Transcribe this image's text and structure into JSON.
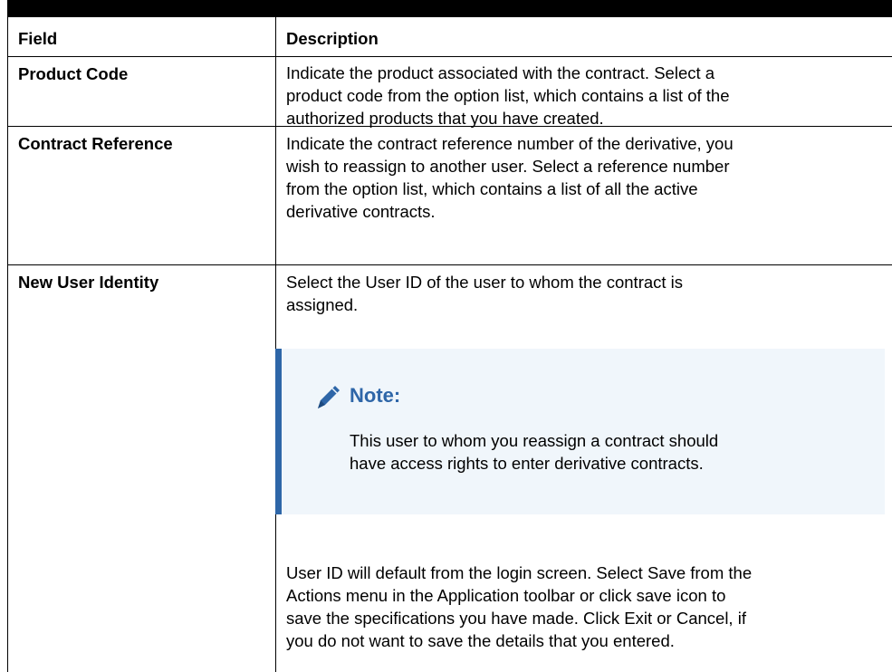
{
  "table": {
    "header": {
      "field": "Field",
      "description": "Description"
    },
    "rows": [
      {
        "field": "Product Code",
        "description": "Indicate the product associated with the contract. Select a\nproduct code from the option list, which contains a list of the\nauthorized products that you have created."
      },
      {
        "field": "Contract Reference",
        "description": "Indicate the contract reference number of the derivative, you\nwish to reassign to another user. Select a reference number\nfrom the option list, which contains a list of all the active\nderivative contracts."
      },
      {
        "field": "New User Identity",
        "description": "Select the User ID of the user to whom the contract is\nassigned.",
        "note": {
          "icon": "pencil-icon",
          "title": "Note:",
          "body": "This user to whom you reassign a contract should\nhave access rights to enter derivative contracts."
        },
        "description_after": "User ID will default from the login screen. Select Save from the\nActions menu in the Application toolbar or click save icon to\nsave the specifications you have made. Click Exit or Cancel, if\nyou do not want to save the details that you entered."
      }
    ]
  },
  "colors": {
    "note_accent": "#2e66a8",
    "note_background": "#f0f6fb"
  }
}
